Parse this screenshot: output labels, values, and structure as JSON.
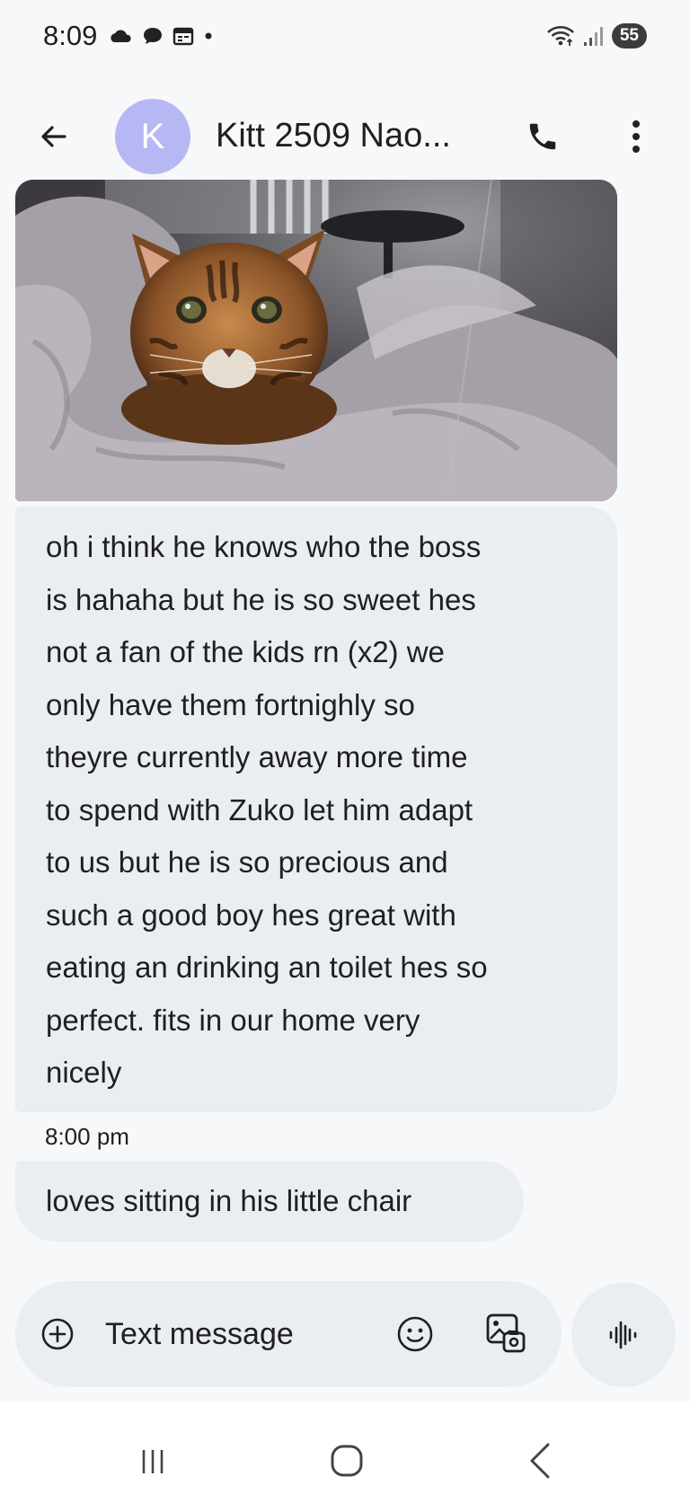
{
  "status_bar": {
    "time": "8:09",
    "battery": "55",
    "left_icons": [
      "cloud-icon",
      "chat-bubble-icon",
      "calendar-icon",
      "dot-icon"
    ],
    "right_icons": [
      "wifi-icon",
      "signal-icon",
      "battery-icon"
    ]
  },
  "header": {
    "avatar_letter": "K",
    "contact_name": "Kitt 2509 Nao...",
    "back_icon": "back-arrow-icon",
    "call_icon": "phone-icon",
    "more_icon": "more-vert-icon"
  },
  "conversation": {
    "messages": [
      {
        "type": "image",
        "description_icon": "photo-cat"
      },
      {
        "type": "text",
        "text": "oh i think he knows who the boss is hahaha but he is so sweet hes not a fan of the kids rn (x2) we only have them fortnighly so theyre currently away more time to spend with Zuko let him adapt to us but he is so precious and such a good boy hes great with eating an drinking an toilet hes so perfect. fits in our home very nicely"
      },
      {
        "type": "text",
        "text": "loves sitting in his little chair"
      }
    ],
    "bubble1_lines": [
      "oh i think he knows who the boss",
      "is hahaha but he is so sweet hes",
      "not a fan of the kids rn (x2) we",
      "only have them fortnighly so",
      "theyre currently away more time",
      "to spend with Zuko let him adapt",
      "to us but he is so precious and",
      "such a good boy hes great with",
      "eating an drinking an toilet hes so",
      "perfect. fits in our home very",
      "nicely"
    ],
    "timestamp": "8:00 pm"
  },
  "compose": {
    "placeholder": "Text message",
    "value": ""
  },
  "colors": {
    "background": "#f7f8fa",
    "bubble": "#eaedf1",
    "avatar": "#b7b8f3",
    "text": "#1f1f1f"
  }
}
